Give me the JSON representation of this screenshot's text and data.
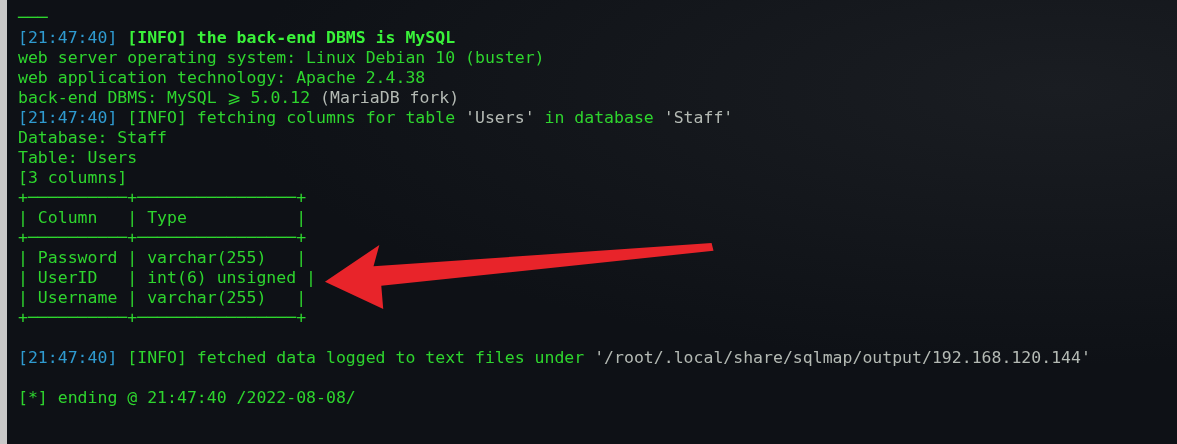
{
  "terminal": {
    "blocks": [
      {
        "lines": [
          {
            "segments": [
              {
                "kind": "text",
                "text": "───"
              }
            ]
          },
          {
            "segments": [
              {
                "kind": "time",
                "text": "[21:47:40]"
              },
              {
                "kind": "bold",
                "text": " [INFO]"
              },
              {
                "kind": "bold",
                "text": " the back-end DBMS is MySQL"
              }
            ]
          },
          {
            "segments": [
              {
                "kind": "text",
                "text": "web server operating system: Linux Debian 10 (buster)"
              }
            ]
          },
          {
            "segments": [
              {
                "kind": "text",
                "text": "web application technology: Apache 2.4.38"
              }
            ]
          },
          {
            "segments": [
              {
                "kind": "text",
                "text": "back-end DBMS: MySQL ⩾ 5.0.12 "
              },
              {
                "kind": "quote",
                "text": "(MariaDB fork)"
              }
            ]
          },
          {
            "segments": [
              {
                "kind": "time",
                "text": "[21:47:40]"
              },
              {
                "kind": "text",
                "text": " [INFO] fetching columns for table "
              },
              {
                "kind": "quote",
                "text": "'Users'"
              },
              {
                "kind": "text",
                "text": " in database "
              },
              {
                "kind": "quote",
                "text": "'Staff'"
              }
            ]
          },
          {
            "segments": [
              {
                "kind": "text",
                "text": "Database: Staff"
              }
            ]
          },
          {
            "segments": [
              {
                "kind": "text",
                "text": "Table: Users"
              }
            ]
          },
          {
            "segments": [
              {
                "kind": "text",
                "text": "[3 columns]"
              }
            ]
          },
          {
            "segments": [
              {
                "kind": "text",
                "text": "+──────────+────────────────+"
              }
            ]
          },
          {
            "segments": [
              {
                "kind": "text",
                "text": "| Column   | Type           |"
              }
            ]
          },
          {
            "segments": [
              {
                "kind": "text",
                "text": "+──────────+────────────────+"
              }
            ]
          },
          {
            "segments": [
              {
                "kind": "text",
                "text": "| Password | varchar(255)   |"
              }
            ]
          },
          {
            "segments": [
              {
                "kind": "text",
                "text": "| UserID   | int(6) unsigned |"
              }
            ]
          },
          {
            "segments": [
              {
                "kind": "text",
                "text": "| Username | varchar(255)   |"
              }
            ]
          },
          {
            "segments": [
              {
                "kind": "text",
                "text": "+──────────+────────────────+"
              }
            ]
          }
        ]
      },
      {
        "lines": [
          {
            "segments": [
              {
                "kind": "time",
                "text": "[21:47:40]"
              },
              {
                "kind": "text",
                "text": " [INFO] fetched data logged to text files under "
              },
              {
                "kind": "quote",
                "text": "'/root/.local/share/sqlmap/output/192.168.120.144'"
              }
            ]
          }
        ]
      },
      {
        "lines": [
          {
            "segments": [
              {
                "kind": "text",
                "text": "[*] ending @ 21:47:40 /2022-08-08/"
              }
            ]
          }
        ]
      }
    ]
  }
}
